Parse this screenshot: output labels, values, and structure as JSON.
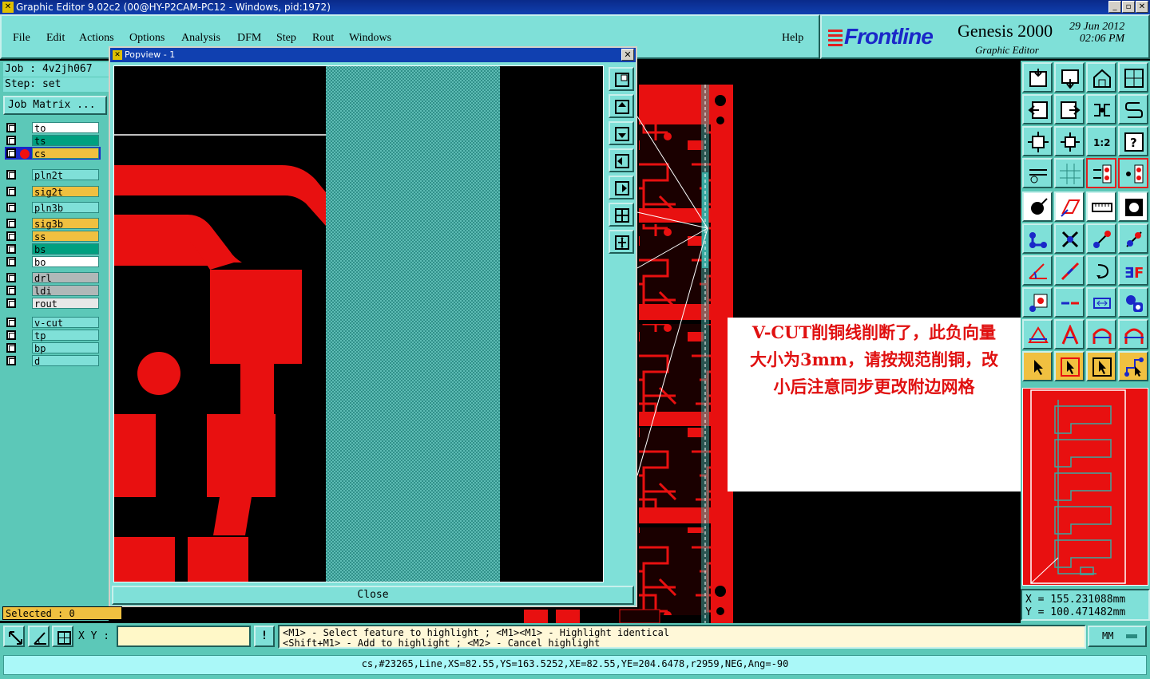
{
  "window": {
    "title": "Graphic Editor 9.02c2 (00@HY-P2CAM-PC12 - Windows, pid:1972)"
  },
  "menu": {
    "items": [
      "File",
      "Edit",
      "Actions",
      "Options",
      "Analysis",
      "DFM",
      "Step",
      "Rout",
      "Windows"
    ],
    "help": "Help"
  },
  "brand": {
    "logo": "Frontline",
    "product": "Genesis 2000",
    "subtitle": "Graphic Editor",
    "date": "29 Jun 2012",
    "time": "02:06 PM"
  },
  "job": {
    "job_line": "Job : 4v2jh067",
    "step_line": "Step: set",
    "matrix_button": "Job Matrix ..."
  },
  "layers": [
    [
      {
        "name": "to",
        "color": "#ffffff"
      },
      {
        "name": "ts",
        "color": "#00a080"
      },
      {
        "name": "cs",
        "color": "#f0c040",
        "active": true
      }
    ],
    [
      {
        "name": "pln2t",
        "color": "#7fe0d8"
      }
    ],
    [
      {
        "name": "sig2t",
        "color": "#f0c040"
      }
    ],
    [
      {
        "name": "pln3b",
        "color": "#7fe0d8"
      }
    ],
    [
      {
        "name": "sig3b",
        "color": "#f0c040"
      },
      {
        "name": "ss",
        "color": "#f0c040"
      },
      {
        "name": "bs",
        "color": "#00a080"
      },
      {
        "name": "bo",
        "color": "#ffffff"
      }
    ],
    [
      {
        "name": "drl",
        "color": "#b0b8b8"
      },
      {
        "name": "ldi",
        "color": "#b0b8b8"
      },
      {
        "name": "rout",
        "color": "#e8e8e8"
      }
    ],
    [
      {
        "name": "v-cut",
        "color": "#7fe0d8"
      },
      {
        "name": "tp",
        "color": "#7fe0d8"
      },
      {
        "name": "bp",
        "color": "#7fe0d8"
      },
      {
        "name": "d",
        "color": "#7fe0d8"
      }
    ]
  ],
  "popview": {
    "title": "Popview - 1",
    "close_label": "Close"
  },
  "annotation": {
    "lines": [
      "V-CUT削铜线削断了，此负向量",
      "大小为3mm，请按规范削铜，改",
      "小后注意同步更改附边网格"
    ]
  },
  "coords": {
    "x": "X  =  155.231088mm",
    "y": "Y  =  100.471482mm"
  },
  "selected": "Selected : 0",
  "xy": {
    "label": "X Y :",
    "value": ""
  },
  "hint": {
    "line1": "<M1> - Select feature to highlight ; <M1><M1> - Highlight identical",
    "line2": "<Shift+M1> - Add to highlight ; <M2> - Cancel highlight"
  },
  "units": "MM",
  "status": "cs,#23265,Line,XS=82.55,YS=163.5252,XE=82.55,YE=204.6478,r2959,NEG,Ang=-90",
  "colors": {
    "panel": "#5cc8b8",
    "panel_light": "#7fe0d8",
    "copper": "#e81010",
    "hatch": "#3aa8a0",
    "highlight": "#f0c040"
  }
}
